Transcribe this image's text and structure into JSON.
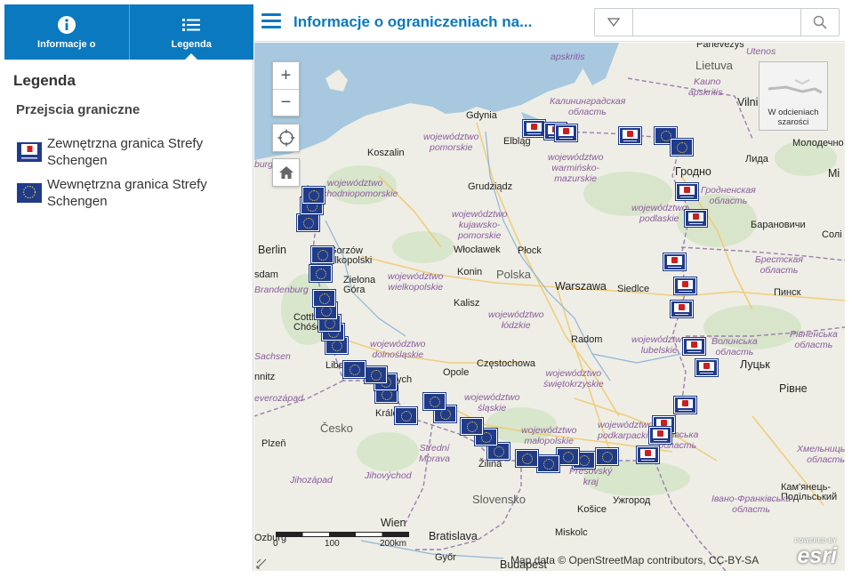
{
  "tabs": [
    {
      "label": "Informacje o",
      "icon": "info-icon",
      "active": false
    },
    {
      "label": "Legenda",
      "icon": "list-icon",
      "active": true
    }
  ],
  "legend": {
    "title": "Legenda",
    "layer": "Przejscia graniczne",
    "items": [
      {
        "label": "Zewnętrzna granica Strefy Schengen",
        "symbol": "external-border-icon"
      },
      {
        "label": "Wewnętrzna granica Strefy Schengen",
        "symbol": "internal-border-icon"
      }
    ]
  },
  "header": {
    "title": "Informacje o ograniczeniach na...",
    "search_placeholder": ""
  },
  "map": {
    "labels": {
      "panevezys": "Panevezys",
      "utenos": "Utenos",
      "apskritis1": "apskritis",
      "lietuva": "Lietuva",
      "kauno": "Kauno",
      "apskritis2": "apskritis",
      "vilni": "Vilni",
      "kaliningrad1": "Калининградская",
      "kaliningrad2": "область",
      "gdynia": "Gdynia",
      "elblag": "Elbląg",
      "koszalin": "Koszalin",
      "pomorskie": "województwo\npomorskie",
      "warminsko": "województwo\nwarmińsko-\nmazurskie",
      "grodno": "Гродно",
      "molodechno": "Молодечно",
      "lida": "Лида",
      "mi": "Мі",
      "zachodniopomorskie": "województwo\nzachodniopomorskie",
      "grudziadz": "Grudziądz",
      "podlaskie": "województwo\npodlaskie",
      "grodnenskaya": "Гродненская\nобласть",
      "baranovichi": "Барановичи",
      "solig": "Солі",
      "kujawsko": "województwo\nkujawsko-\npomorskie",
      "berlin": "Berlin",
      "sdam": "sdam",
      "gorzow": "Gorzów\nelkopolski",
      "wloclawek": "Włocławek",
      "plock": "Płock",
      "konin": "Konin",
      "polska": "Polska",
      "wielkopolskie": "województwo\nwielkopolskie",
      "zielona": "Zielona\nGóra",
      "warszawa": "Warszawa",
      "siedlce": "Siedlce",
      "brestskaya": "Брестская\nобласть",
      "pinsk": "Пинск",
      "brandenburg": "Brandenburg",
      "kalisz": "Kalisz",
      "lodzkie": "województwo\nłódzkie",
      "cottbus": "Cotth\nChóśc",
      "radom": "Radom",
      "lubelskie": "województwo\nlubelskie",
      "volynska": "Волинська\nобласть",
      "rivnenska": "Рівненська\nобласть",
      "sachsen": "Sachsen",
      "dolnoslaskie": "województwo\ndolnośląskie",
      "czestochowa": "Częstochowa",
      "legnica": "Libe",
      "ychs": "ych",
      "swietokrzyskie": "województwo\nświętokrzyskie",
      "lutsk": "Луцьк",
      "opole": "Opole",
      "nitz": "nnitz",
      "severozapad": "everozápad",
      "kral": "Králc",
      "slaskie": "województwo\nśląskie",
      "rivne": "Рівне",
      "cesko": "Česko",
      "malopolskie": "województwo\nmałopolskie",
      "podkarpackie": "województwo\npodkarpackie",
      "lvivska": "Львівська\nобласть",
      "plzen": "Plzeň",
      "stredni": "Střední\nMorava",
      "zilina": "Žilina",
      "presovsky": "Prešovský\nkraj",
      "khmelnytska": "Хмельницька\nобласть",
      "jihozapad": "Jihozápad",
      "jihovychod": "Jihovýchod",
      "kamyanets": "Кам'янець-\nПодільський",
      "slovensko": "Slovensko",
      "uzhgorod": "Ужгород",
      "ivano": "Івано-Франківська\nобласть",
      "kosice": "Košice",
      "wien": "Wien",
      "bratislava": "Bratislava",
      "miskolc": "Miskolc",
      "burg": "burg",
      "gyor": "Győr",
      "budapest": "Budapest",
      "obzburg": "Ozburg"
    },
    "overview_label": "W odcieniach szarości",
    "scalebar": {
      "ticks": [
        "0",
        "100",
        "200km"
      ]
    },
    "attribution": "Map data © OpenStreetMap contributors, CC-BY-SA",
    "esri": {
      "powered": "POWERED BY",
      "brand": "esri"
    },
    "colors": {
      "water": "#a8c8e0",
      "land": "#eeeee6",
      "border": "#9c7fb0",
      "road": "#f1c86a",
      "marker": "#1f3b8a"
    }
  }
}
